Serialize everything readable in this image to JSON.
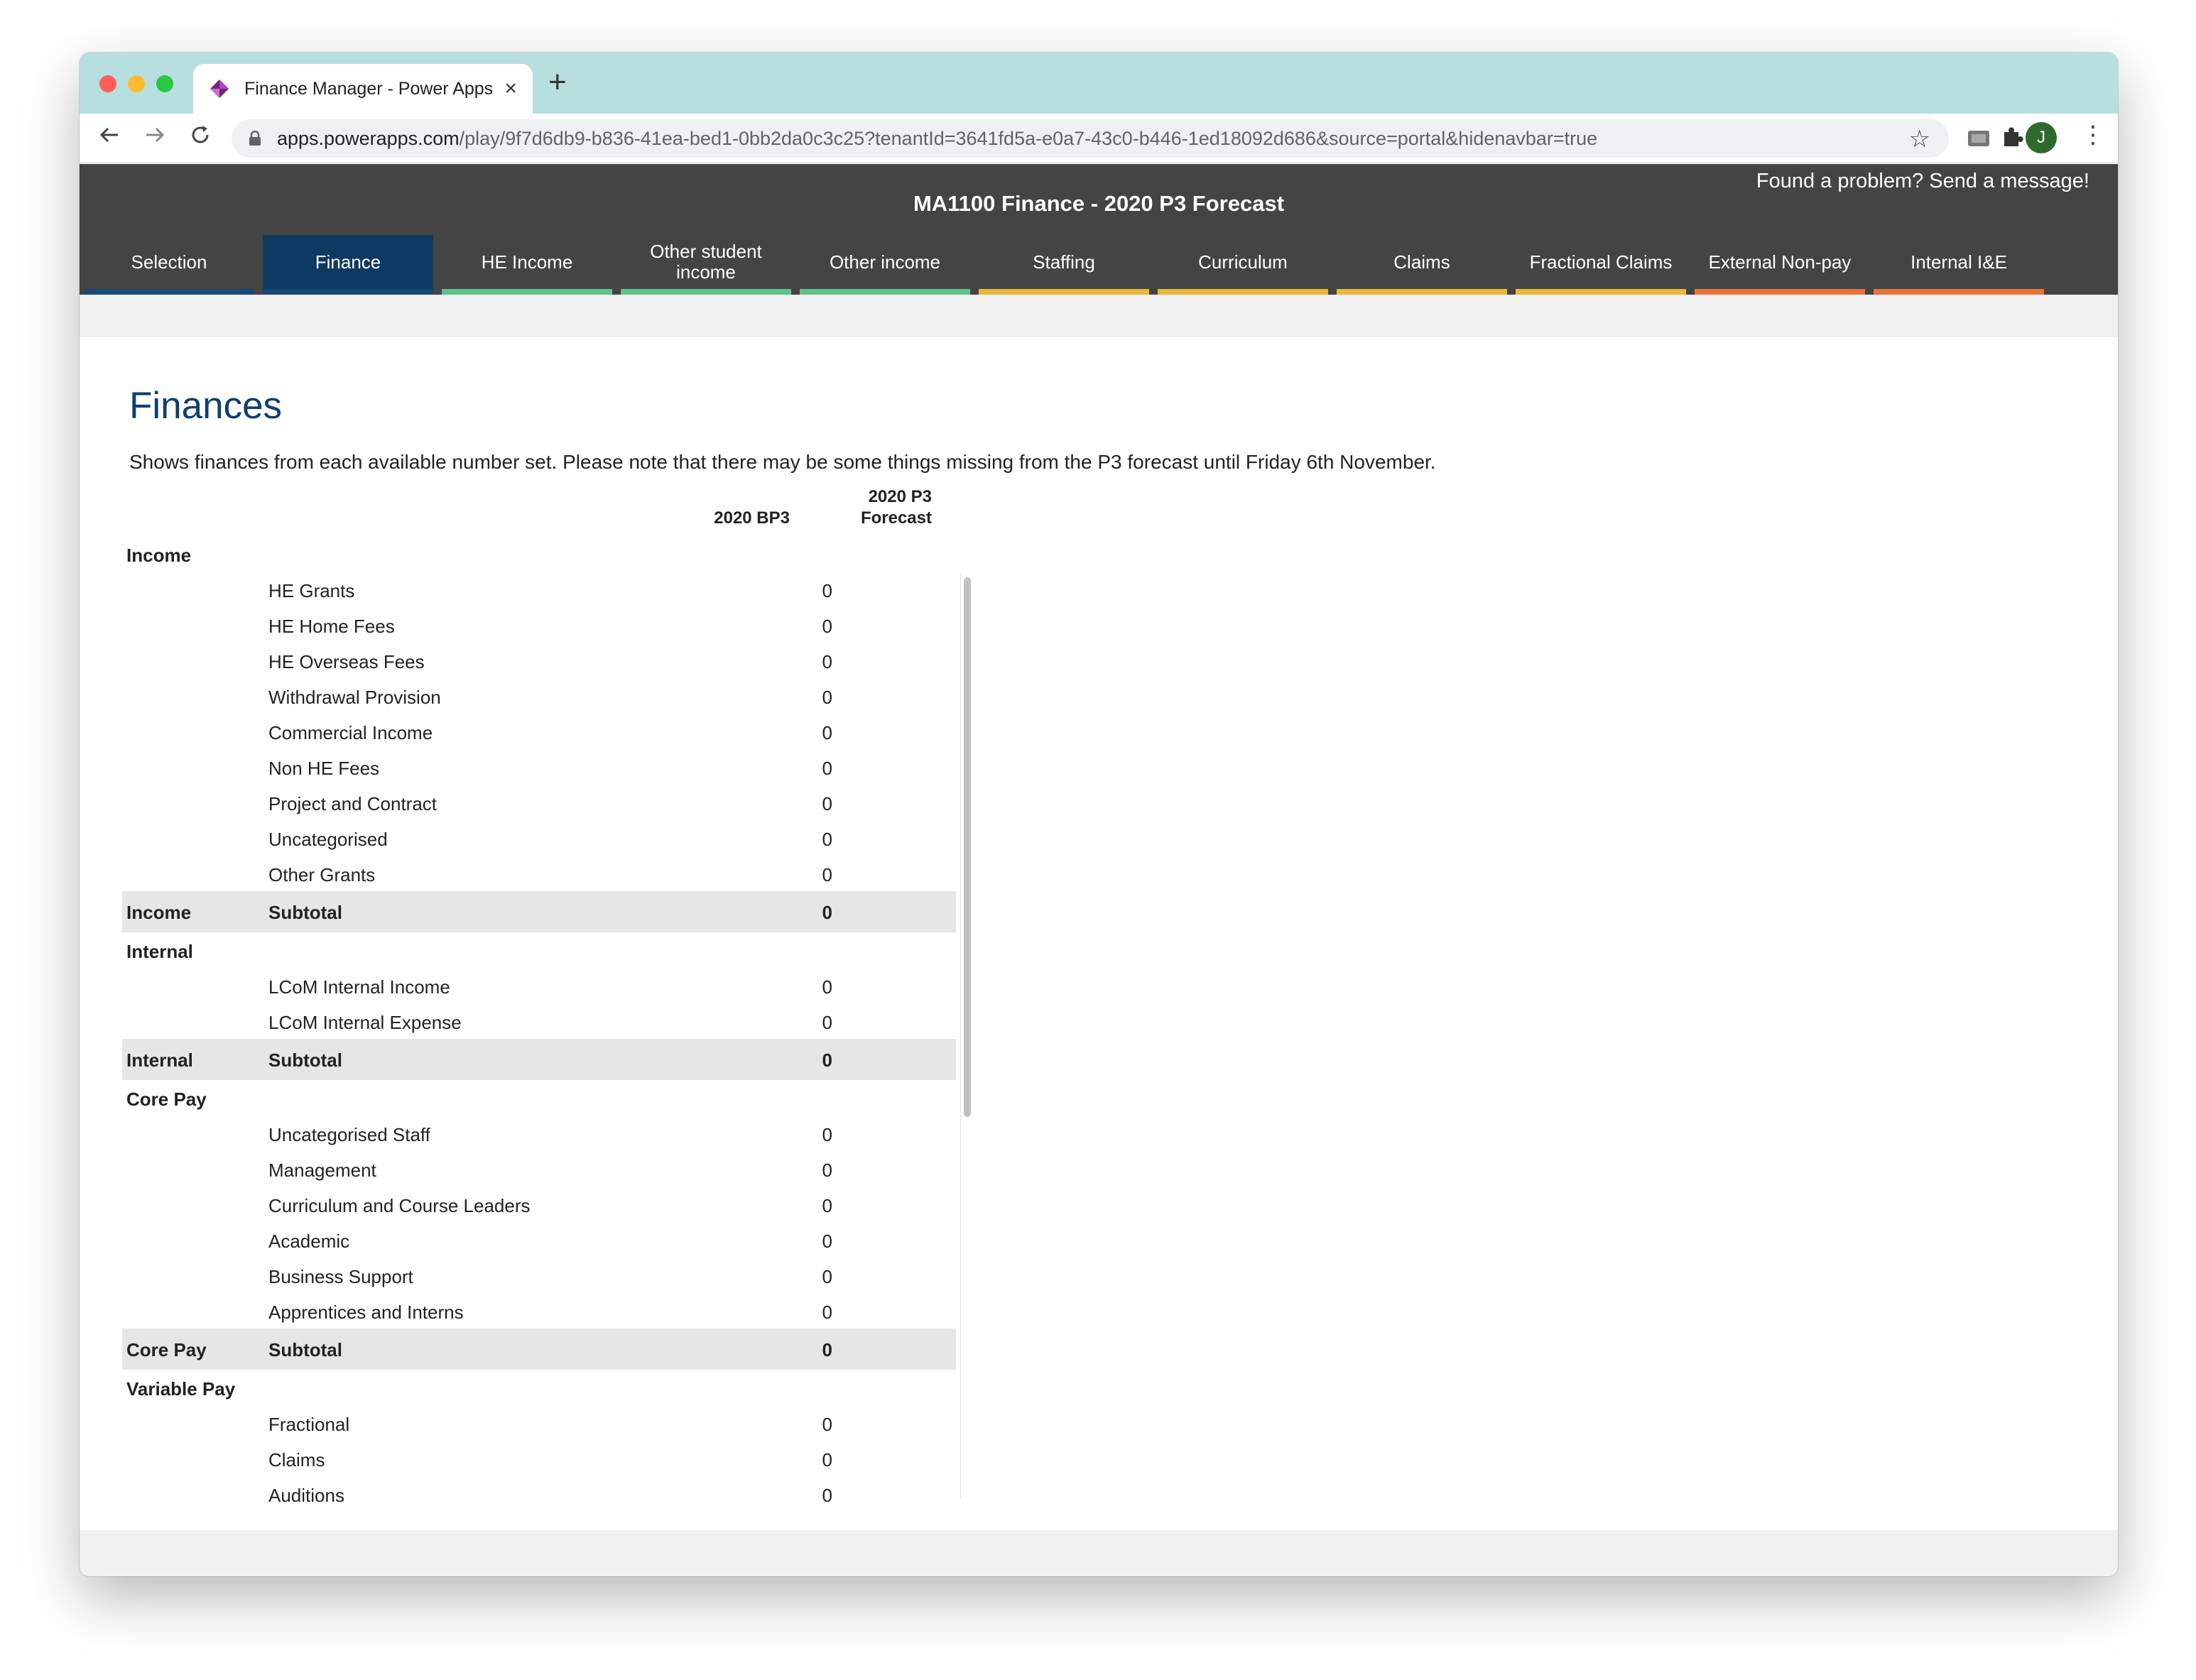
{
  "browser": {
    "tab_title": "Finance Manager - Power Apps",
    "url_host": "apps.powerapps.com",
    "url_path": "/play/9f7d6db9-b836-41ea-bed1-0bb2da0c3c25?tenantId=3641fd5a-e0a7-43c0-b446-1ed18092d686&source=portal&hidenavbar=true",
    "profile_initial": "J",
    "icons": [
      "back-arrow-icon",
      "forward-arrow-icon",
      "reload-icon",
      "lock-icon",
      "bookmark-star-icon",
      "extension-icon",
      "puzzle-icon",
      "menu-dots-icon"
    ]
  },
  "app": {
    "title": "MA1100 Finance - 2020 P3 Forecast",
    "feedback": "Found a problem? Send a message!",
    "tabs": [
      {
        "label": "Selection",
        "color": "#1a4a7a"
      },
      {
        "label": "Finance",
        "color": "#1a4a7a",
        "active": true
      },
      {
        "label": "HE Income",
        "color": "#5fc28a"
      },
      {
        "label": "Other student income",
        "color": "#5fc28a"
      },
      {
        "label": "Other income",
        "color": "#5fc28a"
      },
      {
        "label": "Staffing",
        "color": "#e8b93a"
      },
      {
        "label": "Curriculum",
        "color": "#e8b93a"
      },
      {
        "label": "Claims",
        "color": "#e8b93a"
      },
      {
        "label": "Fractional Claims",
        "color": "#e8b93a"
      },
      {
        "label": "External Non-pay",
        "color": "#e8743b"
      },
      {
        "label": "Internal I&E",
        "color": "#e8743b"
      }
    ],
    "colors": {
      "header_bg": "#444444",
      "active_tab": "#0e3a62",
      "heading": "#0f3e6e"
    }
  },
  "page": {
    "heading": "Finances",
    "description": "Shows finances from each available number set. Please note that there may be some things missing from the P3 forecast until Friday 6th November.",
    "columns": [
      "2020 BP3",
      "2020 P3\nForecast"
    ],
    "rows": [
      {
        "type": "section",
        "section": "Income",
        "label": "",
        "v1": "",
        "v2": ""
      },
      {
        "type": "item",
        "section": "",
        "label": "HE Grants",
        "v1": "0",
        "v2": "0"
      },
      {
        "type": "item",
        "section": "",
        "label": "HE Home Fees",
        "v1": "0",
        "v2": "0"
      },
      {
        "type": "item",
        "section": "",
        "label": "HE Overseas Fees",
        "v1": "0",
        "v2": "0"
      },
      {
        "type": "item",
        "section": "",
        "label": "Withdrawal Provision",
        "v1": "0",
        "v2": "0"
      },
      {
        "type": "item",
        "section": "",
        "label": "Commercial Income",
        "v1": "0",
        "v2": "0"
      },
      {
        "type": "item",
        "section": "",
        "label": "Non HE Fees",
        "v1": "0",
        "v2": "0"
      },
      {
        "type": "item",
        "section": "",
        "label": "Project and Contract",
        "v1": "0",
        "v2": "0"
      },
      {
        "type": "item",
        "section": "",
        "label": "Uncategorised",
        "v1": "0",
        "v2": "0"
      },
      {
        "type": "item",
        "section": "",
        "label": "Other Grants",
        "v1": "0",
        "v2": "0"
      },
      {
        "type": "subtotal",
        "section": "Income",
        "label": "Subtotal",
        "v1": "0",
        "v2": "0"
      },
      {
        "type": "section",
        "section": "Internal",
        "label": "",
        "v1": "",
        "v2": ""
      },
      {
        "type": "item",
        "section": "",
        "label": "LCoM Internal Income",
        "v1": "0",
        "v2": "0"
      },
      {
        "type": "item",
        "section": "",
        "label": "LCoM Internal Expense",
        "v1": "0",
        "v2": "0"
      },
      {
        "type": "subtotal",
        "section": "Internal",
        "label": "Subtotal",
        "v1": "0",
        "v2": "0"
      },
      {
        "type": "section",
        "section": "Core Pay",
        "label": "",
        "v1": "",
        "v2": ""
      },
      {
        "type": "item",
        "section": "",
        "label": "Uncategorised Staff",
        "v1": "0",
        "v2": "0"
      },
      {
        "type": "item",
        "section": "",
        "label": "Management",
        "v1": "0",
        "v2": "0"
      },
      {
        "type": "item",
        "section": "",
        "label": "Curriculum and Course Leaders",
        "v1": "0",
        "v2": "0"
      },
      {
        "type": "item",
        "section": "",
        "label": "Academic",
        "v1": "0",
        "v2": "0"
      },
      {
        "type": "item",
        "section": "",
        "label": "Business Support",
        "v1": "0",
        "v2": "0"
      },
      {
        "type": "item",
        "section": "",
        "label": "Apprentices and Interns",
        "v1": "0",
        "v2": "0"
      },
      {
        "type": "subtotal",
        "section": "Core Pay",
        "label": "Subtotal",
        "v1": "0",
        "v2": "0"
      },
      {
        "type": "section",
        "section": "Variable Pay",
        "label": "",
        "v1": "",
        "v2": ""
      },
      {
        "type": "item",
        "section": "",
        "label": "Fractional",
        "v1": "0",
        "v2": "0"
      },
      {
        "type": "item",
        "section": "",
        "label": "Claims",
        "v1": "0",
        "v2": "0"
      },
      {
        "type": "item",
        "section": "",
        "label": "Auditions",
        "v1": "0",
        "v2": "0"
      }
    ]
  }
}
